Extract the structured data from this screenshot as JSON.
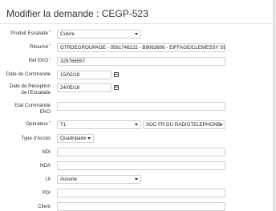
{
  "title": "Modifier la demande : CEGP-523",
  "form": {
    "produit_escalade": {
      "label": "Produit Escalade",
      "value": "Cuivre"
    },
    "resume": {
      "label": "Résumé",
      "value": "GTRDEGROUPAGE - 0561746222 - B9063606 - EIFFAGE/CLEMESSY SERV"
    },
    "ref_eko": {
      "label": "Réf EKO",
      "value": "329766557"
    },
    "date_commande": {
      "label": "Date de Commande",
      "value": "15/02/18"
    },
    "date_reception": {
      "label_line1": "Date de Réception",
      "label_line2": "de l'Escalade",
      "value": "24/05/18"
    },
    "etat_commande": {
      "label_line1": "Etat Commande",
      "label_line2": "EKO",
      "value": ""
    },
    "operateur": {
      "label": "Opérateur",
      "value": "T1",
      "value2": "SOC FR DU RADIOTELEPHONE -"
    },
    "type_acces": {
      "label": "Type d'Accès",
      "value": "Quadripaire"
    },
    "ndi": {
      "label": "NDI",
      "value": ""
    },
    "nda": {
      "label": "NDA",
      "value": ""
    },
    "ui": {
      "label": "UI",
      "value": "Aucune"
    },
    "pdi": {
      "label": "PDI",
      "value": ""
    },
    "client": {
      "label": "Client",
      "value": ""
    }
  }
}
